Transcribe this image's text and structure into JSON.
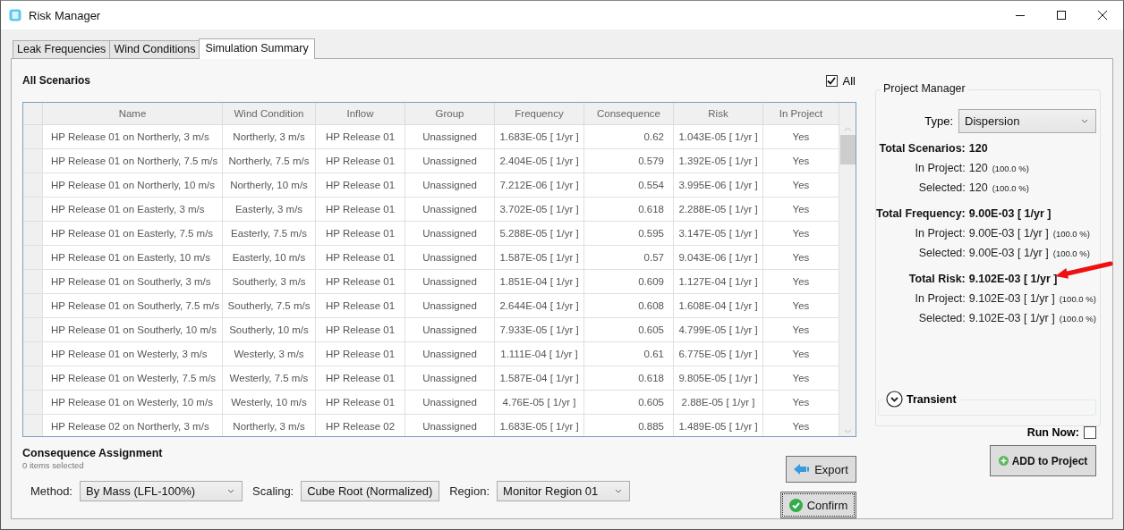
{
  "window": {
    "title": "Risk Manager"
  },
  "tabs": [
    {
      "label": "Leak Frequencies",
      "selected": false
    },
    {
      "label": "Wind Conditions",
      "selected": false
    },
    {
      "label": "Simulation Summary",
      "selected": true
    }
  ],
  "scenarios": {
    "title": "All Scenarios",
    "all_checkbox": {
      "label": "All",
      "checked": true
    },
    "columns": [
      "Name",
      "Wind Condition",
      "Inflow",
      "Group",
      "Frequency",
      "Consequence",
      "Risk",
      "In Project"
    ],
    "rows": [
      [
        "HP Release 01 on Northerly, 3 m/s",
        "Northerly, 3 m/s",
        "HP Release 01",
        "Unassigned",
        "1.683E-05 [ 1/yr ]",
        "0.62",
        "1.043E-05 [ 1/yr ]",
        "Yes"
      ],
      [
        "HP Release 01 on Northerly, 7.5 m/s",
        "Northerly, 7.5 m/s",
        "HP Release 01",
        "Unassigned",
        "2.404E-05 [ 1/yr ]",
        "0.579",
        "1.392E-05 [ 1/yr ]",
        "Yes"
      ],
      [
        "HP Release 01 on Northerly, 10 m/s",
        "Northerly, 10 m/s",
        "HP Release 01",
        "Unassigned",
        "7.212E-06 [ 1/yr ]",
        "0.554",
        "3.995E-06 [ 1/yr ]",
        "Yes"
      ],
      [
        "HP Release 01 on Easterly, 3 m/s",
        "Easterly, 3 m/s",
        "HP Release 01",
        "Unassigned",
        "3.702E-05 [ 1/yr ]",
        "0.618",
        "2.288E-05 [ 1/yr ]",
        "Yes"
      ],
      [
        "HP Release 01 on Easterly, 7.5 m/s",
        "Easterly, 7.5 m/s",
        "HP Release 01",
        "Unassigned",
        "5.288E-05 [ 1/yr ]",
        "0.595",
        "3.147E-05 [ 1/yr ]",
        "Yes"
      ],
      [
        "HP Release 01 on Easterly, 10 m/s",
        "Easterly, 10 m/s",
        "HP Release 01",
        "Unassigned",
        "1.587E-05 [ 1/yr ]",
        "0.57",
        "9.043E-06 [ 1/yr ]",
        "Yes"
      ],
      [
        "HP Release 01 on Southerly, 3 m/s",
        "Southerly, 3 m/s",
        "HP Release 01",
        "Unassigned",
        "1.851E-04 [ 1/yr ]",
        "0.609",
        "1.127E-04 [ 1/yr ]",
        "Yes"
      ],
      [
        "HP Release 01 on Southerly, 7.5 m/s",
        "Southerly, 7.5 m/s",
        "HP Release 01",
        "Unassigned",
        "2.644E-04 [ 1/yr ]",
        "0.608",
        "1.608E-04 [ 1/yr ]",
        "Yes"
      ],
      [
        "HP Release 01 on Southerly, 10 m/s",
        "Southerly, 10 m/s",
        "HP Release 01",
        "Unassigned",
        "7.933E-05 [ 1/yr ]",
        "0.605",
        "4.799E-05 [ 1/yr ]",
        "Yes"
      ],
      [
        "HP Release 01 on Westerly, 3 m/s",
        "Westerly, 3 m/s",
        "HP Release 01",
        "Unassigned",
        "1.111E-04 [ 1/yr ]",
        "0.61",
        "6.775E-05 [ 1/yr ]",
        "Yes"
      ],
      [
        "HP Release 01 on Westerly, 7.5 m/s",
        "Westerly, 7.5 m/s",
        "HP Release 01",
        "Unassigned",
        "1.587E-04 [ 1/yr ]",
        "0.618",
        "9.805E-05 [ 1/yr ]",
        "Yes"
      ],
      [
        "HP Release 01 on Westerly, 10 m/s",
        "Westerly, 10 m/s",
        "HP Release 01",
        "Unassigned",
        "4.76E-05 [ 1/yr ]",
        "0.605",
        "2.88E-05 [ 1/yr ]",
        "Yes"
      ],
      [
        "HP Release 02 on Northerly, 3 m/s",
        "Northerly, 3 m/s",
        "HP Release 02",
        "Unassigned",
        "1.683E-05 [ 1/yr ]",
        "0.885",
        "1.489E-05 [ 1/yr ]",
        "Yes"
      ]
    ]
  },
  "consequence_assignment": {
    "title": "Consequence Assignment",
    "subtitle": "0 items selected",
    "fields": [
      {
        "label": "Method:",
        "value": "By Mass (LFL-100%)"
      },
      {
        "label": "Scaling:",
        "value": "Cube Root (Normalized)"
      },
      {
        "label": "Region:",
        "value": "Monitor Region 01"
      }
    ]
  },
  "export_button": "Export",
  "confirm_button": "Confirm",
  "project_manager": {
    "title": "Project Manager",
    "type_label": "Type:",
    "type_value": "Dispersion",
    "stats": [
      {
        "kind": "total",
        "label": "Total Scenarios:",
        "value": "120"
      },
      {
        "kind": "sub",
        "label": "In Project:",
        "value": "120",
        "percent": "(100.0 %)"
      },
      {
        "kind": "sub",
        "label": "Selected:",
        "value": "120",
        "percent": "(100.0 %)"
      },
      {
        "kind": "total",
        "label": "Total Frequency:",
        "value": "9.00E-03 [ 1/yr ]"
      },
      {
        "kind": "sub",
        "label": "In Project:",
        "value": "9.00E-03 [ 1/yr ]",
        "percent": "(100.0 %)"
      },
      {
        "kind": "sub",
        "label": "Selected:",
        "value": "9.00E-03 [ 1/yr ]",
        "percent": "(100.0 %)"
      },
      {
        "kind": "total",
        "label": "Total Risk:",
        "value": "9.102E-03 [ 1/yr ]"
      },
      {
        "kind": "sub",
        "label": "In Project:",
        "value": "9.102E-03 [ 1/yr ]",
        "percent": "(100.0 %)"
      },
      {
        "kind": "sub",
        "label": "Selected:",
        "value": "9.102E-03 [ 1/yr ]",
        "percent": "(100.0 %)"
      }
    ],
    "transient": {
      "label": "Transient",
      "expanded": false
    },
    "run_now": {
      "label": "Run Now:",
      "checked": false
    },
    "add_button": "ADD to Project"
  }
}
